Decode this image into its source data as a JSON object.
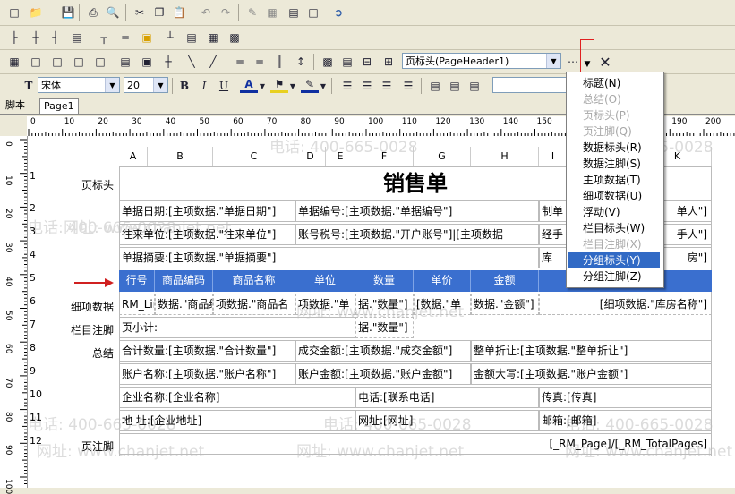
{
  "toolbar3": {
    "band_select": "页标头(PageHeader1)"
  },
  "toolbar4": {
    "font_name": "宋体",
    "font_size": "20"
  },
  "tabs": [
    {
      "label": "脚本"
    },
    {
      "label": "Page1"
    }
  ],
  "ruler": {
    "labels": [
      "0",
      "10",
      "20",
      "30",
      "40",
      "50",
      "60",
      "70",
      "80",
      "90",
      "100",
      "110",
      "120",
      "130",
      "140",
      "150",
      "160",
      "170",
      "180",
      "190",
      "200"
    ]
  },
  "vruler": {
    "labels": [
      "0",
      "10",
      "20",
      "30",
      "40",
      "50",
      "60",
      "70",
      "80",
      "90",
      "100"
    ]
  },
  "columns": [
    "A",
    "B",
    "C",
    "D",
    "E",
    "F",
    "G",
    "H",
    "I",
    "J",
    "K"
  ],
  "rows": {
    "numbers": [
      "1",
      "2",
      "3",
      "4",
      "5",
      "6",
      "7",
      "8",
      "9",
      "10",
      "11",
      "12"
    ],
    "headers": [
      "页标头",
      "",
      "",
      "",
      "",
      "细项数据",
      "栏目注脚",
      "总结",
      "",
      "",
      "",
      "页注脚"
    ]
  },
  "report": {
    "title": "销售单",
    "r2": [
      "单据日期:[主项数据.\"单据日期\"]",
      "单据编号:[主项数据.\"单据编号\"]",
      "制单",
      "单人\"]"
    ],
    "r3": [
      "往来单位:[主项数据.\"往来单位\"]",
      "账号税号:[主项数据.\"开户账号\"]|[主项数据",
      "经手",
      "手人\"]"
    ],
    "r4": [
      "单据摘要:[主项数据.\"单据摘要\"]",
      "库",
      "房\"]"
    ],
    "header_cells": [
      "行号",
      "商品编码",
      "商品名称",
      "单位",
      "数量",
      "单价",
      "金额"
    ],
    "r6": [
      "RM_Lir",
      "数据.\"商品编",
      "项数据.\"商品名",
      "项数据.\"单",
      "据.\"数量\"]",
      "[数据.\"单",
      "数据.\"金额\"]",
      "[细项数据.\"库房名称\"]"
    ],
    "r7": [
      "页小计:",
      "据.\"数量\"]"
    ],
    "r8": [
      "合计数量:[主项数据.\"合计数量\"]",
      "成交金额:[主项数据.\"成交金额\"]",
      "整单折让:[主项数据.\"整单折让\"]"
    ],
    "r9": [
      "账户名称:[主项数据.\"账户名称\"]",
      "账户金额:[主项数据.\"账户金额\"]",
      "金额大写:[主项数据.\"账户金额\"]"
    ],
    "r10": [
      "企业名称:[企业名称]",
      "电话:[联系电话]",
      "传真:[传真]"
    ],
    "r11": [
      "地  址:[企业地址]",
      "网址:[网址]",
      "邮箱:[邮箱]"
    ],
    "r12": [
      "[_RM_Page]/[_RM_TotalPages]"
    ]
  },
  "watermark": {
    "phone": "电话: 400-665-0028",
    "site": "网址: www.chanjet.net"
  },
  "dropdown_menu": {
    "items": [
      {
        "label": "标题(N)",
        "state": "normal"
      },
      {
        "label": "总结(O)",
        "state": "disabled"
      },
      {
        "label": "页标头(P)",
        "state": "disabled"
      },
      {
        "label": "页注脚(Q)",
        "state": "disabled"
      },
      {
        "label": "数据标头(R)",
        "state": "normal"
      },
      {
        "label": "数据注脚(S)",
        "state": "normal"
      },
      {
        "label": "主项数据(T)",
        "state": "normal"
      },
      {
        "label": "细项数据(U)",
        "state": "normal"
      },
      {
        "label": "浮动(V)",
        "state": "normal"
      },
      {
        "label": "栏目标头(W)",
        "state": "normal"
      },
      {
        "label": "栏目注脚(X)",
        "state": "disabled"
      },
      {
        "label": "分组标头(Y)",
        "state": "selected"
      },
      {
        "label": "分组注脚(Z)",
        "state": "normal"
      }
    ]
  },
  "colors": {
    "header_row": "#3a6fcf",
    "menu_highlight": "#316ac5",
    "arrow": "#d02020"
  }
}
